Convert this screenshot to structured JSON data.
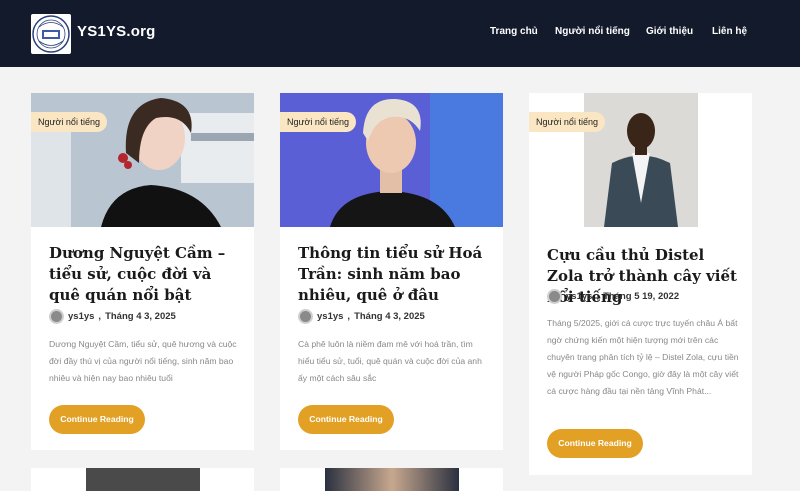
{
  "site": {
    "logo_title": "YS1YS.org",
    "nav": [
      "Trang chủ",
      "Người nổi tiếng",
      "Giới thiệu",
      "Liên hệ"
    ]
  },
  "colors": {
    "header_bg": "#131a2c",
    "accent": "#e2a125",
    "badge_bg": "#fbe6c3",
    "page_bg": "#f3f3f3"
  },
  "posts": [
    {
      "category": "Người nổi tiếng",
      "title": "Dương Nguyệt Cầm – tiểu sử, cuộc đời và quê quán nổi bật",
      "author": "ys1ys",
      "date": "Tháng 4 3, 2025",
      "excerpt": "Dương Nguyệt Cầm, tiểu sử, quê hương và cuộc đời đầy thú vị của người nổi tiếng, sinh năm bao nhiêu và hiện nay bao nhiêu tuổi",
      "button": "Continue Reading"
    },
    {
      "category": "Người nổi tiếng",
      "title": "Thông tin tiểu sử Hoá Trần: sinh năm bao nhiêu, quê ở đâu",
      "author": "ys1ys",
      "date": "Tháng 4 3, 2025",
      "excerpt": "Cà phê luôn là niềm đam mê với hoá trần, tìm hiểu tiểu sử, tuổi, quê quán và cuộc đời của anh ấy một cách sâu sắc",
      "button": "Continue Reading"
    },
    {
      "category": "Người nổi tiếng",
      "title": "Cựu cầu thủ Distel Zola trở thành cây viết nổi tiếng",
      "author": "ys1ys",
      "date": "Tháng 5 19, 2022",
      "excerpt": "Tháng 5/2025, giới cá cược trực tuyến châu Á bất ngờ chứng kiến một hiện tượng mới trên các chuyên trang phân tích tỷ lệ – Distel Zola, cựu tiền vệ người Pháp gốc Congo, giờ đây là một cây viết cá cược hàng đầu tại nền tảng Vĩnh Phát...",
      "button": "Continue Reading"
    }
  ]
}
